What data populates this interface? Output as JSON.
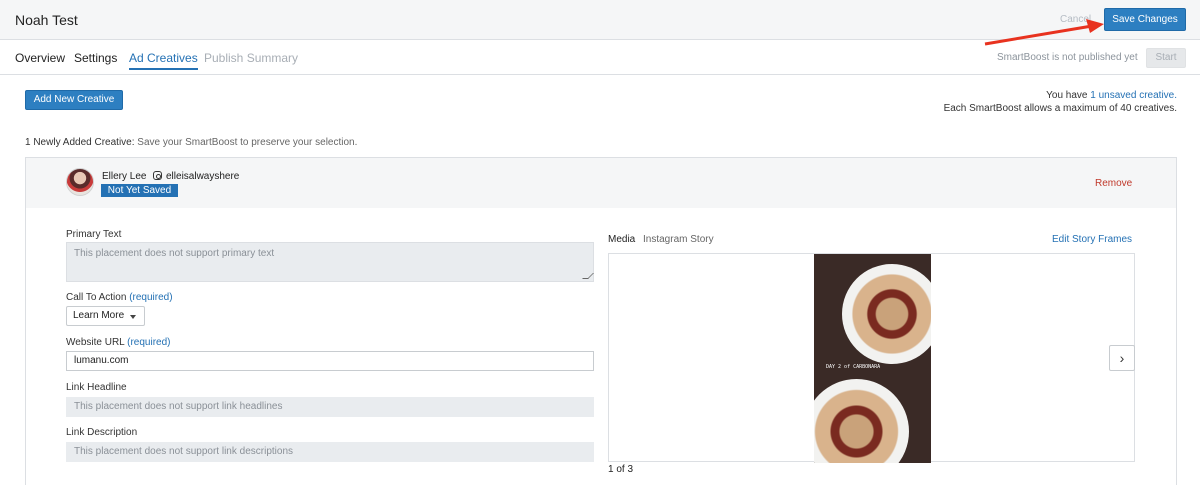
{
  "header": {
    "title": "Noah Test",
    "cancel_label": "Cancel",
    "save_label": "Save Changes"
  },
  "tabs": [
    {
      "label": "Overview"
    },
    {
      "label": "Settings"
    },
    {
      "label": "Ad Creatives"
    },
    {
      "label": "Publish Summary"
    }
  ],
  "publish": {
    "status": "SmartBoost is not published yet",
    "start_label": "Start"
  },
  "toolbar": {
    "add_creative_label": "Add New Creative"
  },
  "unsaved": {
    "prefix": "You have ",
    "link": "1 unsaved creative.",
    "limit": "Each SmartBoost allows a maximum of 40 creatives."
  },
  "added_note": {
    "strong": "1 Newly Added Creative:",
    "muted": "Save your SmartBoost to preserve your selection."
  },
  "creative": {
    "user_name": "Ellery Lee",
    "handle": "elleisalwayshere",
    "badge": "Not Yet Saved",
    "remove_label": "Remove",
    "primary_text": {
      "label": "Primary Text",
      "placeholder": "This placement does not support primary text"
    },
    "cta": {
      "label": "Call To Action",
      "required": "(required)",
      "value": "Learn More"
    },
    "website": {
      "label": "Website URL",
      "required": "(required)",
      "value": "lumanu.com"
    },
    "link_headline": {
      "label": "Link Headline",
      "placeholder": "This placement does not support link headlines"
    },
    "link_description": {
      "label": "Link Description",
      "placeholder": "This placement does not support link descriptions"
    },
    "media": {
      "label": "Media",
      "type": "Instagram Story",
      "edit_label": "Edit Story Frames",
      "story_caption": "DAY 2 of CARBONARA",
      "pager": "1 of 3",
      "next_icon": "chevron-right-icon"
    }
  },
  "colors": {
    "accent": "#2471b4",
    "button": "#2d7fc1",
    "danger": "#c0392b",
    "annotation": "#e8321f"
  }
}
